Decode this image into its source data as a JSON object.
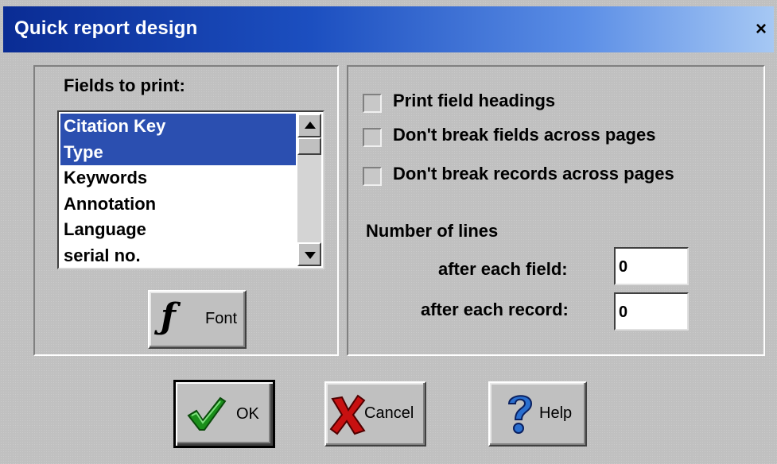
{
  "window": {
    "title": "Quick report design",
    "close_label": "×"
  },
  "fields_panel": {
    "label": "Fields to print:",
    "items": [
      {
        "label": "Citation Key",
        "selected": true
      },
      {
        "label": "Type",
        "selected": true
      },
      {
        "label": "Keywords",
        "selected": false
      },
      {
        "label": "Annotation",
        "selected": false
      },
      {
        "label": "Language",
        "selected": false
      },
      {
        "label": "serial no.",
        "selected": false
      }
    ],
    "font_button": {
      "icon": "font-f-icon",
      "icon_glyph": "ƒ",
      "label": "Font"
    }
  },
  "options_panel": {
    "checkboxes": [
      {
        "label": "Print field headings",
        "checked": false
      },
      {
        "label": "Don't break fields across pages",
        "checked": false
      },
      {
        "label": "Don't break records across pages",
        "checked": false
      }
    ],
    "lines_heading": "Number of lines",
    "after_field_label": "after each field:",
    "after_field_value": "0",
    "after_record_label": "after each record:",
    "after_record_value": "0"
  },
  "buttons": {
    "ok_label": "OK",
    "ok_icon": "checkmark-icon",
    "cancel_label": "Cancel",
    "cancel_icon": "x-mark-icon",
    "help_label": "Help",
    "help_icon": "question-mark-icon"
  },
  "colors": {
    "titlebar_start": "#0a2c94",
    "titlebar_end": "#a6c8f4",
    "selection": "#2b4fb0",
    "dialog_bg": "#c0c0c0"
  }
}
